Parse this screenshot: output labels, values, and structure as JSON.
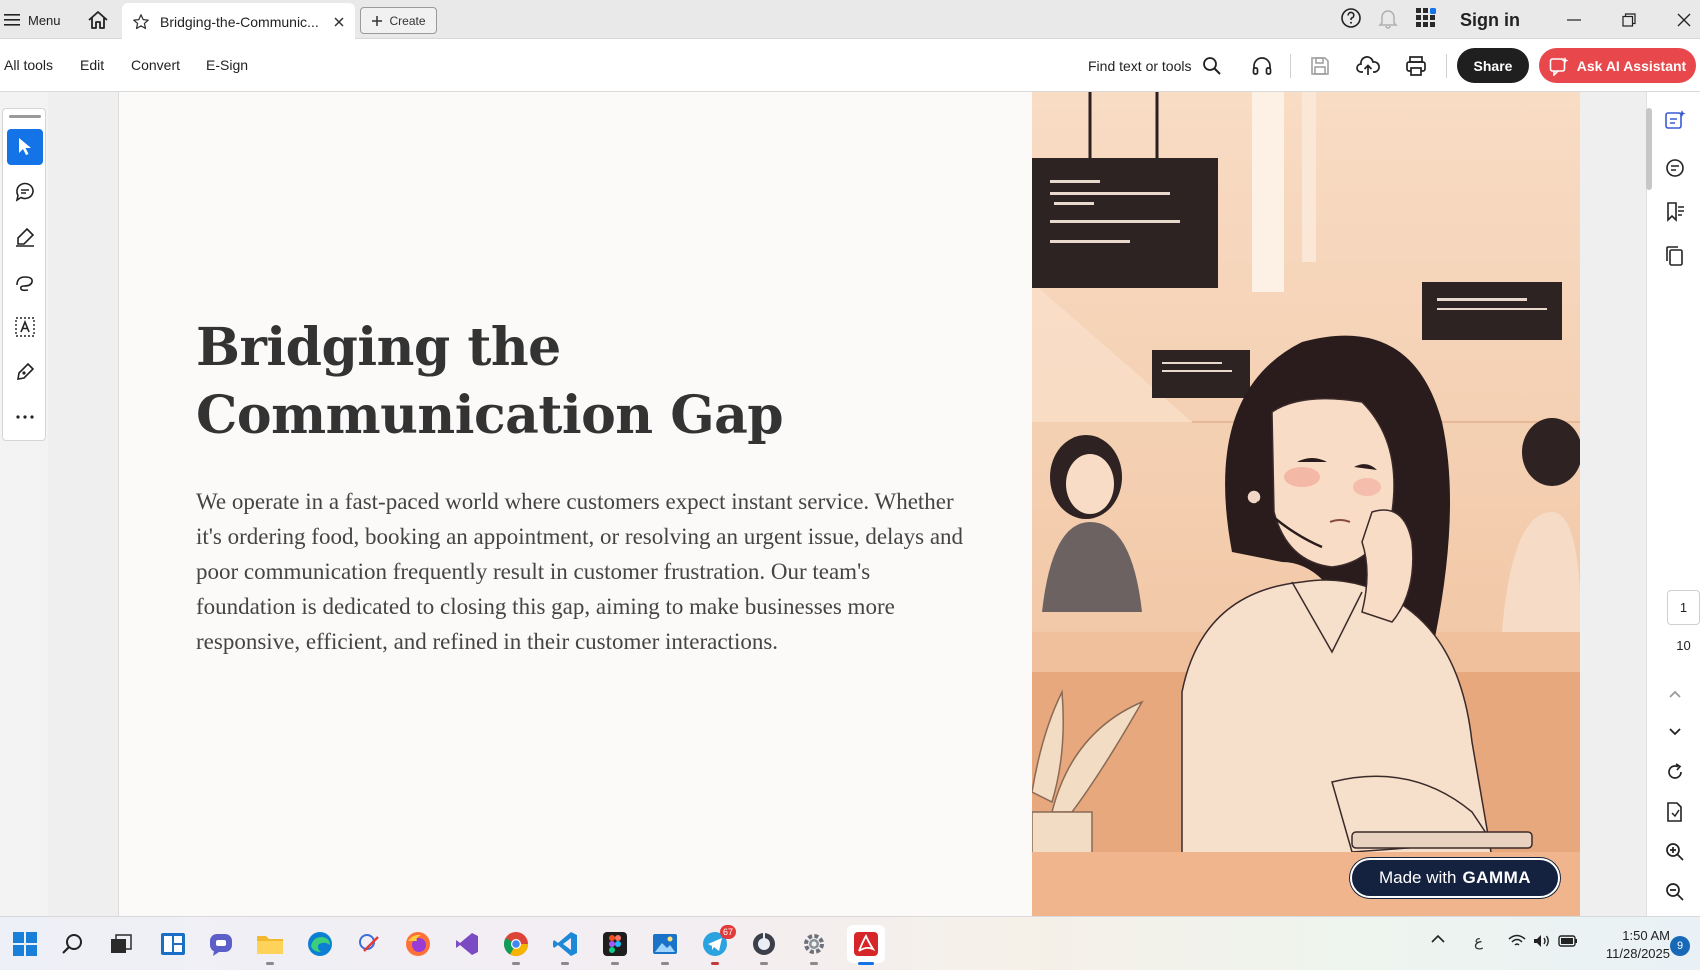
{
  "titlebar": {
    "menu_label": "Menu",
    "tab_title": "Bridging-the-Communic...",
    "create_label": "Create",
    "sign_in": "Sign in"
  },
  "toolbar": {
    "all_tools": "All tools",
    "edit": "Edit",
    "convert": "Convert",
    "esign": "E-Sign",
    "find_label": "Find text or tools",
    "share": "Share",
    "ai_assistant": "Ask AI Assistant"
  },
  "document": {
    "title": "Bridging the Communication Gap",
    "body": "We operate in a fast-paced world where customers expect instant service. Whether it's ordering food, booking an appointment, or resolving an urgent issue, delays and poor communication frequently result in customer frustration. Our team's foundation is dedicated to closing this gap, aiming to make businesses more responsive, efficient, and refined in their customer interactions.",
    "badge_prefix": "Made with",
    "badge_brand": "GAMMA"
  },
  "pager": {
    "current_page": "1",
    "total_pages": "10"
  },
  "taskbar": {
    "telegram_badge": "67",
    "lang": "ع",
    "time": "1:50 AM",
    "date": "11/28/2025",
    "notifications": "9"
  },
  "colors": {
    "accent": "#1473e6",
    "ai_button": "#e8474c",
    "share_button": "#1f1f1f",
    "badge_bg": "#142240"
  }
}
